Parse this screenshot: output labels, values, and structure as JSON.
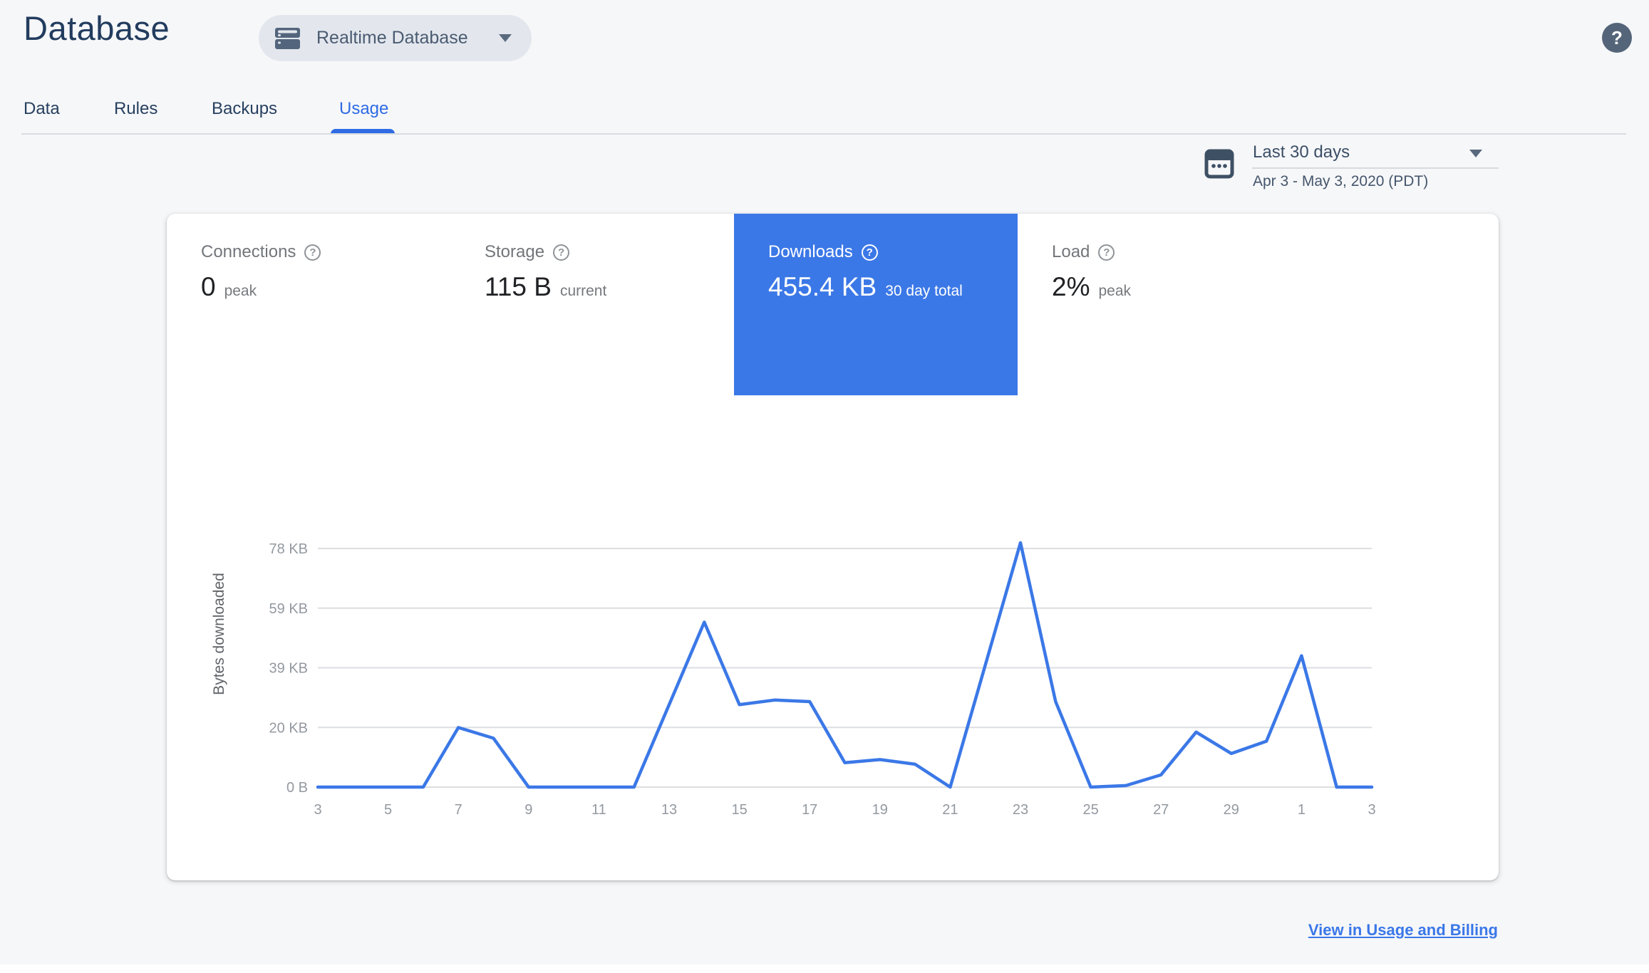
{
  "header": {
    "title": "Database",
    "database_selector": {
      "label": "Realtime Database"
    },
    "help_glyph": "?"
  },
  "tabs": [
    {
      "label": "Data",
      "active": false
    },
    {
      "label": "Rules",
      "active": false
    },
    {
      "label": "Backups",
      "active": false
    },
    {
      "label": "Usage",
      "active": true
    }
  ],
  "date_range": {
    "label": "Last 30 days",
    "detail": "Apr 3 - May 3, 2020 (PDT)"
  },
  "metrics": [
    {
      "name": "Connections",
      "help_glyph": "?",
      "value": "0",
      "sub_label": "peak",
      "selected": false
    },
    {
      "name": "Storage",
      "help_glyph": "?",
      "value": "115 B",
      "sub_label": "current",
      "selected": false
    },
    {
      "name": "Downloads",
      "help_glyph": "?",
      "value": "455.4 KB",
      "sub_label": "30 day total",
      "selected": true
    },
    {
      "name": "Load",
      "help_glyph": "?",
      "value": "2%",
      "sub_label": "peak",
      "selected": false
    }
  ],
  "chart_data": {
    "type": "line",
    "ylabel": "Bytes downloaded",
    "grid": true,
    "legend": "none",
    "ylim_kb": [
      0,
      83
    ],
    "line_color": "#3b78e7",
    "categories": [
      "Apr 3",
      "Apr 4",
      "Apr 5",
      "Apr 6",
      "Apr 7",
      "Apr 8",
      "Apr 9",
      "Apr 10",
      "Apr 11",
      "Apr 12",
      "Apr 13",
      "Apr 14",
      "Apr 15",
      "Apr 16",
      "Apr 17",
      "Apr 18",
      "Apr 19",
      "Apr 20",
      "Apr 21",
      "Apr 22",
      "Apr 23",
      "Apr 24",
      "Apr 25",
      "Apr 26",
      "Apr 27",
      "Apr 28",
      "Apr 29",
      "Apr 30",
      "May 1",
      "May 2",
      "May 3"
    ],
    "series": [
      {
        "name": "Bytes downloaded",
        "values_kb": [
          0,
          0,
          0,
          0,
          19.5,
          16,
          0,
          0,
          0,
          0,
          27,
          54,
          27,
          28.5,
          28,
          8,
          9,
          7.5,
          0,
          40,
          80,
          28,
          0,
          0.5,
          4,
          18,
          11,
          15,
          43,
          0,
          0
        ]
      }
    ],
    "y_ticks": [
      {
        "kb": 0,
        "label": "0 B"
      },
      {
        "kb": 19.53,
        "label": "20 KB"
      },
      {
        "kb": 39.06,
        "label": "39 KB"
      },
      {
        "kb": 58.59,
        "label": "59 KB"
      },
      {
        "kb": 78.13,
        "label": "78 KB"
      }
    ],
    "x_ticks": [
      {
        "index": 0,
        "label": "3"
      },
      {
        "index": 2,
        "label": "5"
      },
      {
        "index": 4,
        "label": "7"
      },
      {
        "index": 6,
        "label": "9"
      },
      {
        "index": 8,
        "label": "11"
      },
      {
        "index": 10,
        "label": "13"
      },
      {
        "index": 12,
        "label": "15"
      },
      {
        "index": 14,
        "label": "17"
      },
      {
        "index": 16,
        "label": "19"
      },
      {
        "index": 18,
        "label": "21"
      },
      {
        "index": 20,
        "label": "23"
      },
      {
        "index": 22,
        "label": "25"
      },
      {
        "index": 24,
        "label": "27"
      },
      {
        "index": 26,
        "label": "29"
      },
      {
        "index": 28,
        "label": "1"
      },
      {
        "index": 30,
        "label": "3"
      }
    ]
  },
  "footer": {
    "link_label": "View in Usage and Billing"
  },
  "colors": {
    "accent_blue": "#2e6be4",
    "tile_blue": "#3b78e7",
    "line_blue": "#3b78e7",
    "link_blue": "#3a77e8",
    "grid_gray": "#dcdee1",
    "tick_gray": "#9399a0",
    "navy": "#223c5e",
    "slate": "#4a5b71",
    "page_bg": "#f6f7f9"
  }
}
